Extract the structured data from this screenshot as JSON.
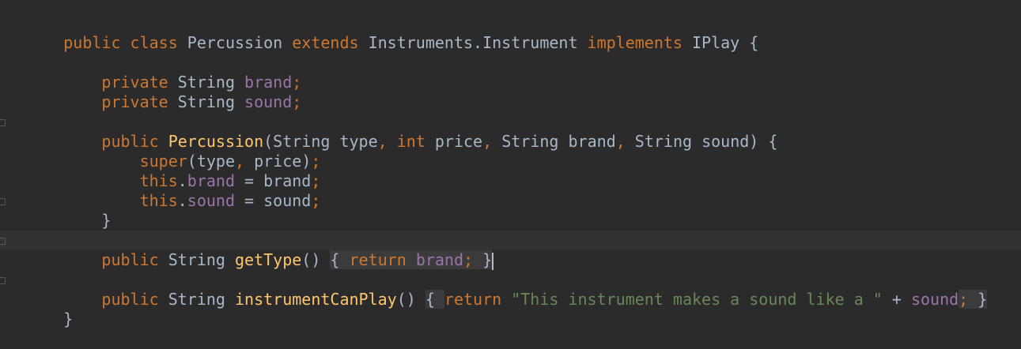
{
  "editor": {
    "language": "Java",
    "colors": {
      "background": "#2b2b2b",
      "keyword": "#cc7832",
      "identifier": "#a9b7c6",
      "field": "#9876aa",
      "method": "#ffc66d",
      "string": "#6a8759"
    },
    "lines": {
      "l1": {
        "t1": "public class ",
        "t2": "Percussion ",
        "t3": "extends ",
        "t4": "Instruments.Instrument ",
        "t5": "implements ",
        "t6": "IPlay {"
      },
      "l3": {
        "t1": "    private ",
        "t2": "String ",
        "t3": "brand",
        "t4": ";"
      },
      "l4": {
        "t1": "    private ",
        "t2": "String ",
        "t3": "sound",
        "t4": ";"
      },
      "l6": {
        "t1": "    public ",
        "t2": "Percussion",
        "t3": "(String type",
        "t4": ", ",
        "t5": "int ",
        "t6": "price",
        "t7": ", ",
        "t8": "String brand",
        "t9": ", ",
        "t10": "String sound) {"
      },
      "l7": {
        "t1": "        super",
        "t2": "(type",
        "t3": ", ",
        "t4": "price)",
        "t5": ";"
      },
      "l8": {
        "t1": "        this",
        "t2": ".",
        "t3": "brand",
        "t4": " = brand",
        "t5": ";"
      },
      "l9": {
        "t1": "        this",
        "t2": ".",
        "t3": "sound",
        "t4": " = sound",
        "t5": ";"
      },
      "l10": {
        "t1": "    }"
      },
      "l12": {
        "t1": "    public ",
        "t2": "String ",
        "t3": "getType",
        "t4": "() ",
        "t5": "{ ",
        "t6": "return ",
        "t7": "brand",
        "t8": "; ",
        "t9": "}"
      },
      "l14": {
        "t1": "    public ",
        "t2": "String ",
        "t3": "instrumentCanPlay",
        "t4": "() ",
        "t5": "{ ",
        "t6": "return ",
        "t7": "\"This instrument makes a sound like a \"",
        "t8": " + ",
        "t9": "sound",
        "t10": "; ",
        "t11": "}"
      },
      "l15": {
        "t1": "}"
      }
    }
  }
}
